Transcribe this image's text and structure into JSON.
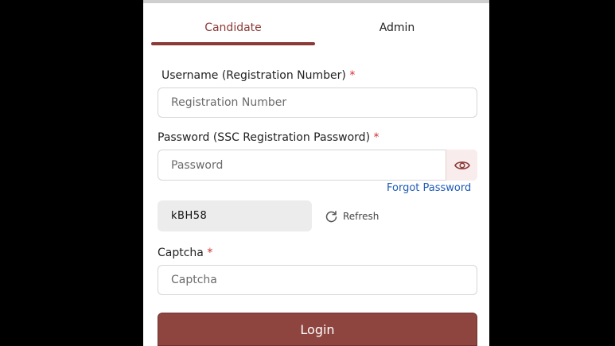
{
  "tabs": [
    {
      "label": "Candidate",
      "active": true
    },
    {
      "label": "Admin",
      "active": false
    }
  ],
  "username": {
    "label": "Username (Registration Number)",
    "required_mark": "*",
    "placeholder": "Registration Number",
    "value": ""
  },
  "password": {
    "label": "Password (SSC Registration Password)",
    "required_mark": "*",
    "placeholder": "Password",
    "value": "",
    "toggle_icon": "eye-icon"
  },
  "forgot_password": "Forgot Password",
  "captcha": {
    "code": "kBH58",
    "refresh_label": "Refresh",
    "refresh_icon": "refresh-icon",
    "label": "Captcha",
    "required_mark": "*",
    "placeholder": "Captcha",
    "value": ""
  },
  "login_label": "Login",
  "colors": {
    "accent": "#8b3a36",
    "button": "#8e4540",
    "link": "#1e5bb8",
    "required": "#d32f2f"
  }
}
